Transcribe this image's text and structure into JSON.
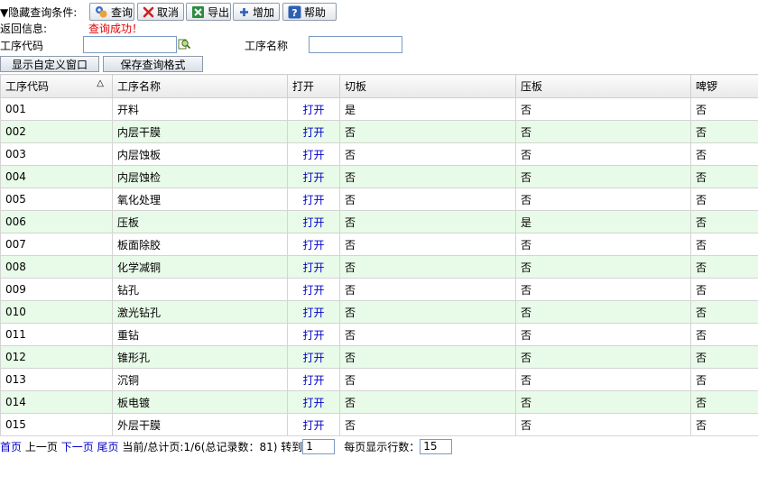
{
  "toolbar": {
    "toggle_label": "▼隐藏查询条件:",
    "query": "查询",
    "cancel": "取消",
    "export": "导出",
    "add": "增加",
    "help": "帮助"
  },
  "status": {
    "label": "返回信息:",
    "message": "查询成功！",
    "message_color": "#e60000"
  },
  "filters": {
    "code_label": "工序代码",
    "code_value": "",
    "name_label": "工序名称",
    "name_value": ""
  },
  "actions": {
    "custom_window": "显示自定义窗口",
    "save_format": "保存查询格式"
  },
  "table": {
    "headers": [
      "工序代码",
      "工序名称",
      "打开",
      "切板",
      "压板",
      "啤锣"
    ],
    "open_label": "打开",
    "rows": [
      {
        "code": "001",
        "name": "开料",
        "cut": "是",
        "press": "否",
        "punch": "否"
      },
      {
        "code": "002",
        "name": "内层干膜",
        "cut": "否",
        "press": "否",
        "punch": "否"
      },
      {
        "code": "003",
        "name": "内层蚀板",
        "cut": "否",
        "press": "否",
        "punch": "否"
      },
      {
        "code": "004",
        "name": "内层蚀检",
        "cut": "否",
        "press": "否",
        "punch": "否"
      },
      {
        "code": "005",
        "name": "氧化处理",
        "cut": "否",
        "press": "否",
        "punch": "否"
      },
      {
        "code": "006",
        "name": "压板",
        "cut": "否",
        "press": "是",
        "punch": "否"
      },
      {
        "code": "007",
        "name": "板面除胶",
        "cut": "否",
        "press": "否",
        "punch": "否"
      },
      {
        "code": "008",
        "name": "化学减铜",
        "cut": "否",
        "press": "否",
        "punch": "否"
      },
      {
        "code": "009",
        "name": "钻孔",
        "cut": "否",
        "press": "否",
        "punch": "否"
      },
      {
        "code": "010",
        "name": "激光钻孔",
        "cut": "否",
        "press": "否",
        "punch": "否"
      },
      {
        "code": "011",
        "name": "重钻",
        "cut": "否",
        "press": "否",
        "punch": "否"
      },
      {
        "code": "012",
        "name": "锥形孔",
        "cut": "否",
        "press": "否",
        "punch": "否"
      },
      {
        "code": "013",
        "name": "沉铜",
        "cut": "否",
        "press": "否",
        "punch": "否"
      },
      {
        "code": "014",
        "name": "板电镀",
        "cut": "否",
        "press": "否",
        "punch": "否"
      },
      {
        "code": "015",
        "name": "外层干膜",
        "cut": "否",
        "press": "否",
        "punch": "否"
      }
    ]
  },
  "pager": {
    "first": "首页",
    "prev": "上一页",
    "next": "下一页",
    "last": "尾页",
    "info": "当前/总计页:1/6(总记录数：81) 转到",
    "goto_value": "1",
    "rows_label": "每页显示行数：",
    "rows_value": "15"
  }
}
